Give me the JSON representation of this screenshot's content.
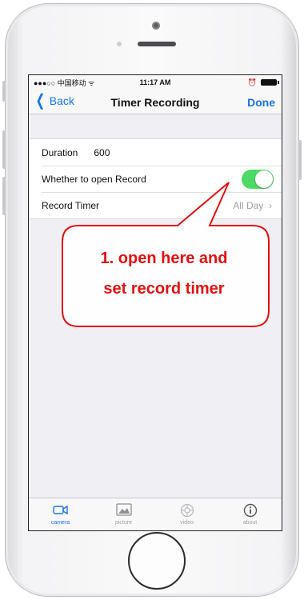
{
  "status_bar": {
    "carrier": "●●●○○ 中国移动 ᯤ",
    "time": "11:17 AM"
  },
  "nav": {
    "back_label": "Back",
    "title": "Timer Recording",
    "done_label": "Done"
  },
  "settings": {
    "duration_label": "Duration",
    "duration_value": "600",
    "open_record_label": "Whether to open Record",
    "open_record_enabled": true,
    "record_timer_label": "Record Timer",
    "record_timer_value": "All Day"
  },
  "tabs": [
    {
      "label": "camera",
      "icon": "camera-icon",
      "active": true
    },
    {
      "label": "picture",
      "icon": "picture-icon",
      "active": false
    },
    {
      "label": "video",
      "icon": "video-icon",
      "active": false
    },
    {
      "label": "about",
      "icon": "info-icon",
      "active": false
    }
  ],
  "annotation": {
    "line1": "1. open here and",
    "line2": "set record timer",
    "color": "#e01010"
  },
  "colors": {
    "accent": "#1a73e8",
    "toggle_on": "#4cd964"
  }
}
